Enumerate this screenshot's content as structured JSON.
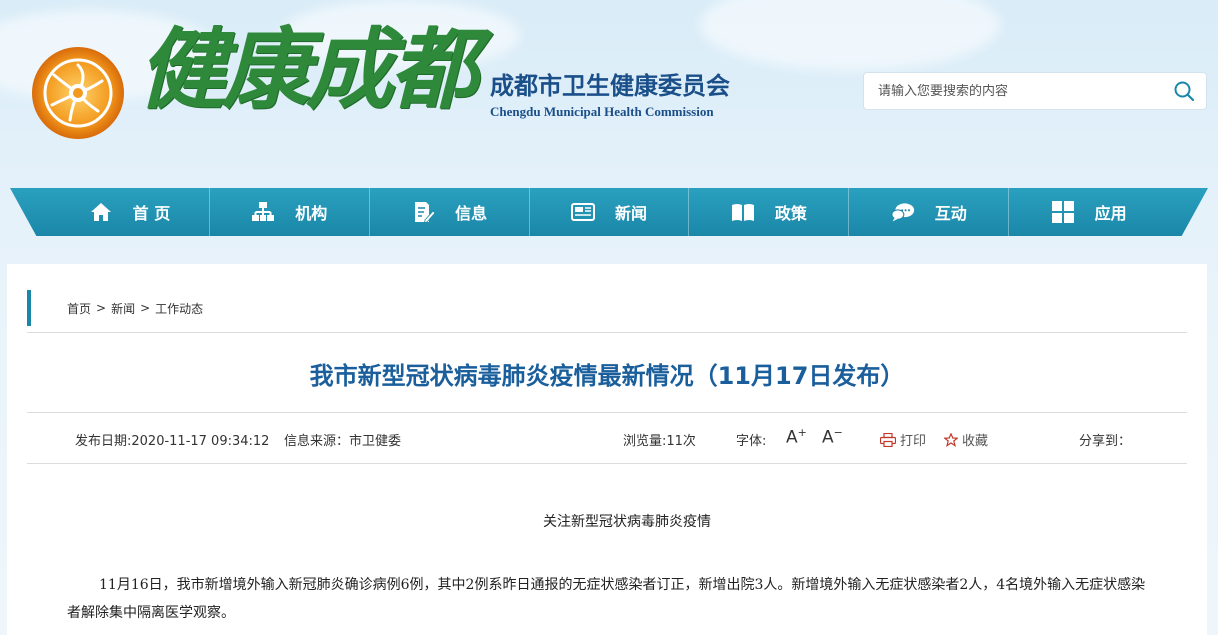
{
  "header": {
    "logo_title": "健康成都",
    "org_cn": "成都市卫生健康委员会",
    "org_en": "Chengdu Municipal Health Commission",
    "search_placeholder": "请输入您要搜索的内容",
    "search_icon": "search-icon"
  },
  "nav": {
    "items": [
      {
        "label": "首 页",
        "icon": "home-icon"
      },
      {
        "label": "机构",
        "icon": "org-chart-icon"
      },
      {
        "label": "信息",
        "icon": "document-edit-icon"
      },
      {
        "label": "新闻",
        "icon": "newspaper-icon"
      },
      {
        "label": "政策",
        "icon": "book-icon"
      },
      {
        "label": "互动",
        "icon": "chat-bubbles-icon"
      },
      {
        "label": "应用",
        "icon": "apps-grid-icon"
      }
    ]
  },
  "breadcrumb": {
    "items": [
      "首页",
      "新闻",
      "工作动态"
    ],
    "separator": ">"
  },
  "article": {
    "title": "我市新型冠状病毒肺炎疫情最新情况（11月17日发布）",
    "publish_date": "发布日期:2020-11-17 09:34:12",
    "source": "信息来源：市卫健委",
    "views": "浏览量:11次",
    "font_label": "字体:",
    "font_increase": "A",
    "font_decrease": "A",
    "print_label": "打印",
    "favorite_label": "收藏",
    "share_label": "分享到：",
    "intro": "关注新型冠状病毒肺炎疫情",
    "paragraph": "11月16日，我市新增境外输入新冠肺炎确诊病例6例，其中2例系昨日通报的无症状感染者订正，新增出院3人。新增境外输入无症状感染者2人，4名境外输入无症状感染者解除集中隔离医学观察。"
  },
  "colors": {
    "nav_bg": "#1b87a8",
    "title_blue": "#1a5f9c",
    "logo_green": "#2e8a3a",
    "org_blue": "#1a4f8a"
  }
}
